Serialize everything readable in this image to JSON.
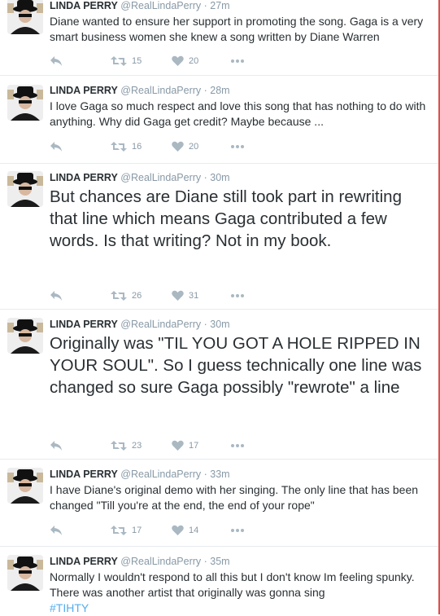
{
  "tweets": [
    {
      "name": "LINDA PERRY",
      "handle": "@RealLindaPerry",
      "time": "· 27m",
      "text": "Diane wanted to ensure her support in promoting the song. Gaga is a very smart business women she knew a song written by Diane Warren",
      "retweets": "15",
      "likes": "20"
    },
    {
      "name": "LINDA PERRY",
      "handle": "@RealLindaPerry",
      "time": "· 28m",
      "text": "I love Gaga so much respect and love this song that has nothing to do with anything. Why did Gaga get credit? Maybe because ...",
      "retweets": "16",
      "likes": "20"
    },
    {
      "name": "LINDA PERRY",
      "handle": "@RealLindaPerry",
      "time": "· 30m",
      "text": "But chances are Diane still took part in rewriting that line which means Gaga contributed a few words. Is that writing? Not in my book.",
      "retweets": "26",
      "likes": "31"
    },
    {
      "name": "LINDA PERRY",
      "handle": "@RealLindaPerry",
      "time": "· 30m",
      "text": "Originally was \"TIL YOU GOT A HOLE RIPPED IN YOUR SOUL\".  So I guess technically one line was changed so sure Gaga possibly \"rewrote\" a line",
      "retweets": "23",
      "likes": "17"
    },
    {
      "name": "LINDA PERRY",
      "handle": "@RealLindaPerry",
      "time": "· 33m",
      "text": "I have Diane's original demo with her singing. The only line that has been changed \"Till you're at the end, the end of your rope\"",
      "retweets": "17",
      "likes": "14"
    },
    {
      "name": "LINDA PERRY",
      "handle": "@RealLindaPerry",
      "time": "· 35m",
      "text": "Normally I wouldn't respond to all this but I don't know Im feeling spunky. There was another artist that originally was gonna sing",
      "hashtag": "#TIHTY"
    }
  ],
  "icons": {
    "reply": "reply-icon",
    "retweet": "retweet-icon",
    "like": "heart-icon",
    "more": "more-dots-icon"
  },
  "colors": {
    "name": "#292f33",
    "meta": "#8899a6",
    "icon": "#aab8c2",
    "hashtag": "#55acee",
    "divider": "#e6ecf0"
  }
}
